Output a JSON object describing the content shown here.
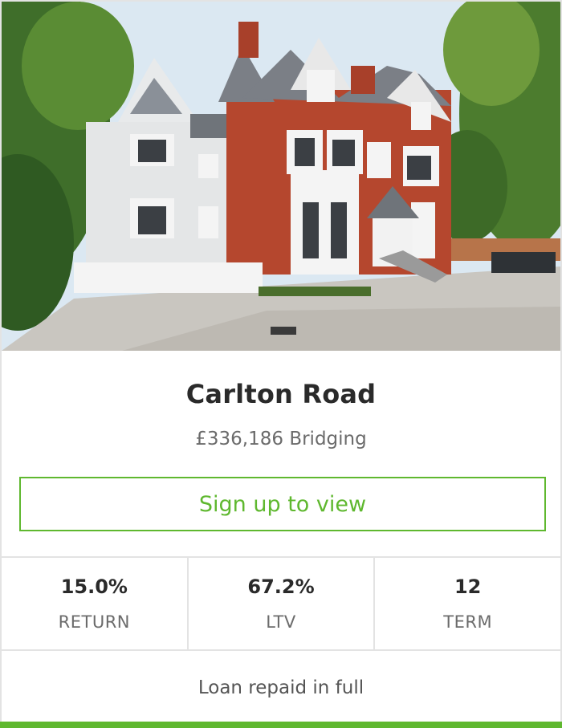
{
  "listing": {
    "photo_alt": "",
    "title": "Carlton Road",
    "subtitle": "£336,186 Bridging",
    "cta_label": "Sign up to view",
    "stats": [
      {
        "value": "15.0%",
        "label": "RETURN"
      },
      {
        "value": "67.2%",
        "label": "LTV"
      },
      {
        "value": "12",
        "label": "TERM"
      }
    ],
    "status_text": "Loan repaid in full",
    "status_progress": 1.0
  },
  "colors": {
    "accent": "#5fb82f",
    "border": "#e3e3e3",
    "title": "#2a2a2a",
    "muted": "#6b6b6b"
  }
}
